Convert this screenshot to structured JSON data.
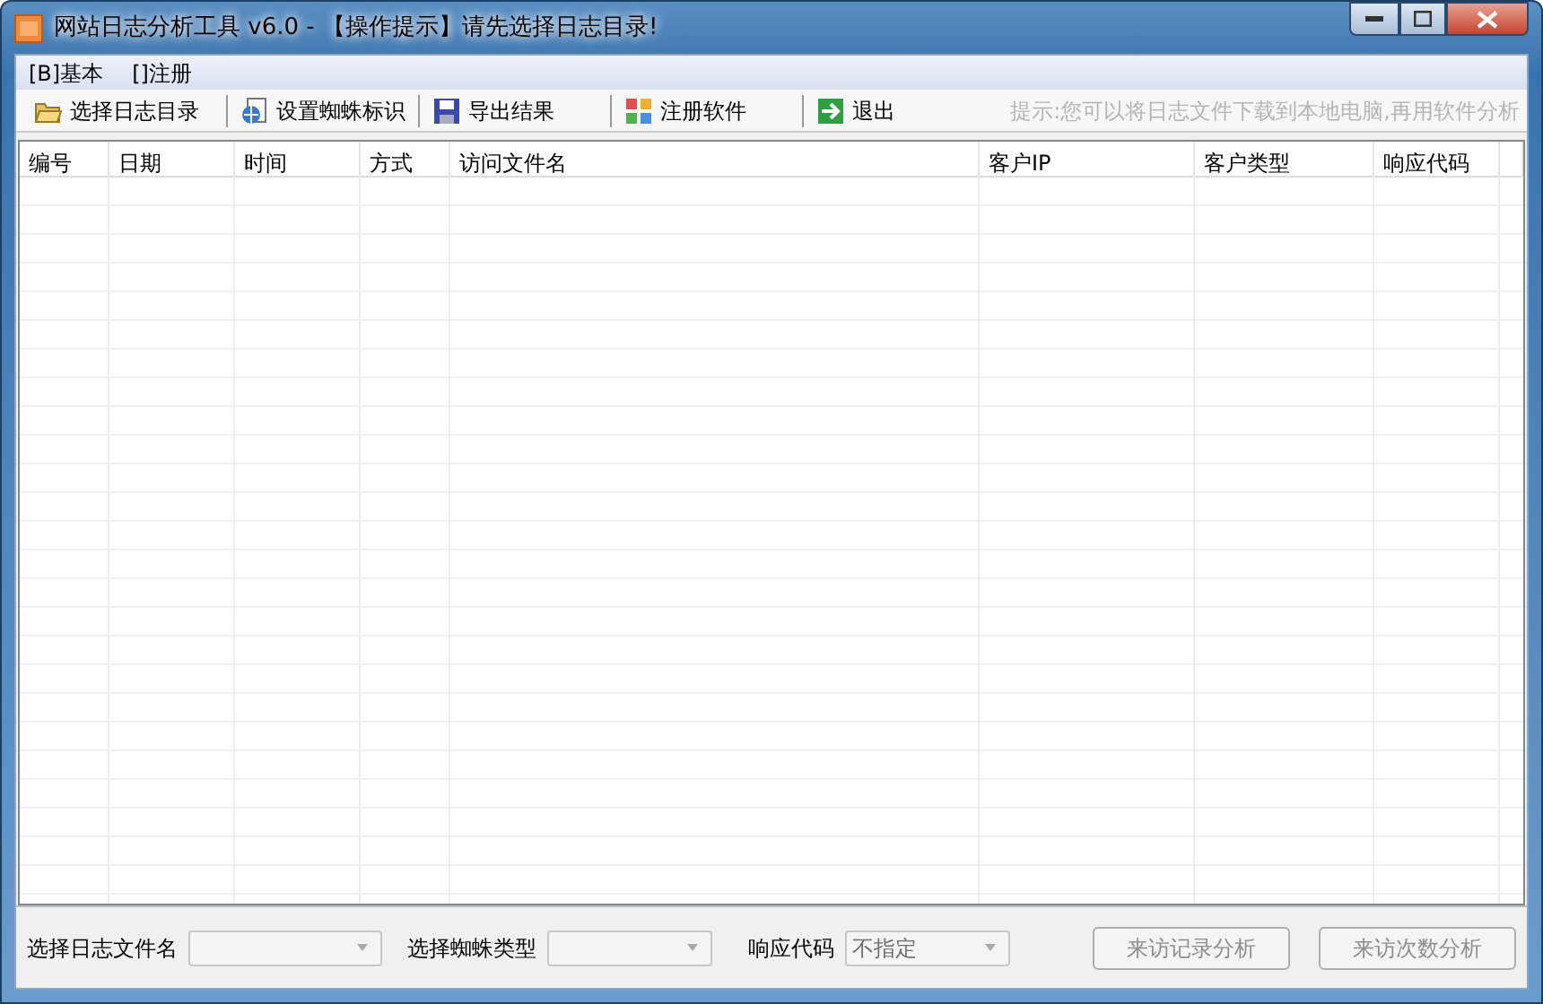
{
  "window": {
    "title": "网站日志分析工具 v6.0 - 【操作提示】请先选择日志目录!"
  },
  "menu": [
    "[B]基本",
    "[]注册"
  ],
  "toolbar": [
    {
      "label": "选择日志目录"
    },
    {
      "label": "设置蜘蛛标识"
    },
    {
      "label": "导出结果"
    },
    {
      "label": "注册软件"
    },
    {
      "label": "退出"
    }
  ],
  "hint": "提示:您可以将日志文件下载到本地电脑,再用软件分析",
  "table": {
    "columns": [
      "编号",
      "日期",
      "时间",
      "方式",
      "访问文件名",
      "客户IP",
      "客户类型",
      "响应代码"
    ]
  },
  "filters": [
    {
      "label": "选择日志文件名",
      "disabled": true
    },
    {
      "label": "选择蜘蛛类型",
      "disabled": true
    },
    {
      "label": "响应代码",
      "value": "不指定",
      "disabled": true
    }
  ],
  "buttons": [
    {
      "label": "来访记录分析",
      "disabled": true
    },
    {
      "label": "来访次数分析",
      "disabled": true
    }
  ]
}
